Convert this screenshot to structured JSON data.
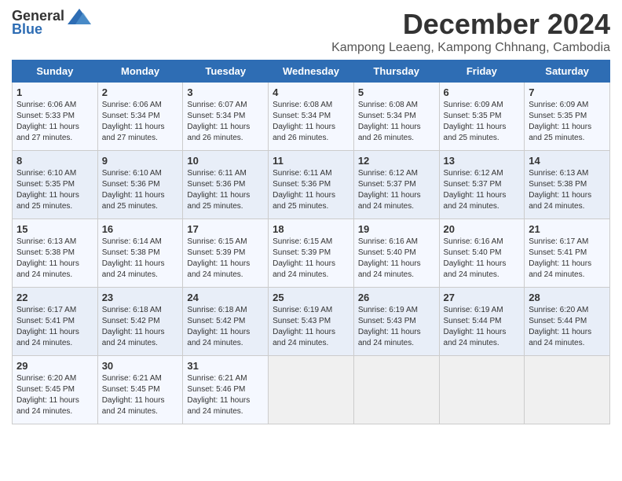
{
  "header": {
    "logo_general": "General",
    "logo_blue": "Blue",
    "month_title": "December 2024",
    "subtitle": "Kampong Leaeng, Kampong Chhnang, Cambodia"
  },
  "weekdays": [
    "Sunday",
    "Monday",
    "Tuesday",
    "Wednesday",
    "Thursday",
    "Friday",
    "Saturday"
  ],
  "weeks": [
    [
      {
        "day": "1",
        "sunrise": "Sunrise: 6:06 AM",
        "sunset": "Sunset: 5:33 PM",
        "daylight": "Daylight: 11 hours and 27 minutes."
      },
      {
        "day": "2",
        "sunrise": "Sunrise: 6:06 AM",
        "sunset": "Sunset: 5:34 PM",
        "daylight": "Daylight: 11 hours and 27 minutes."
      },
      {
        "day": "3",
        "sunrise": "Sunrise: 6:07 AM",
        "sunset": "Sunset: 5:34 PM",
        "daylight": "Daylight: 11 hours and 26 minutes."
      },
      {
        "day": "4",
        "sunrise": "Sunrise: 6:08 AM",
        "sunset": "Sunset: 5:34 PM",
        "daylight": "Daylight: 11 hours and 26 minutes."
      },
      {
        "day": "5",
        "sunrise": "Sunrise: 6:08 AM",
        "sunset": "Sunset: 5:34 PM",
        "daylight": "Daylight: 11 hours and 26 minutes."
      },
      {
        "day": "6",
        "sunrise": "Sunrise: 6:09 AM",
        "sunset": "Sunset: 5:35 PM",
        "daylight": "Daylight: 11 hours and 25 minutes."
      },
      {
        "day": "7",
        "sunrise": "Sunrise: 6:09 AM",
        "sunset": "Sunset: 5:35 PM",
        "daylight": "Daylight: 11 hours and 25 minutes."
      }
    ],
    [
      {
        "day": "8",
        "sunrise": "Sunrise: 6:10 AM",
        "sunset": "Sunset: 5:35 PM",
        "daylight": "Daylight: 11 hours and 25 minutes."
      },
      {
        "day": "9",
        "sunrise": "Sunrise: 6:10 AM",
        "sunset": "Sunset: 5:36 PM",
        "daylight": "Daylight: 11 hours and 25 minutes."
      },
      {
        "day": "10",
        "sunrise": "Sunrise: 6:11 AM",
        "sunset": "Sunset: 5:36 PM",
        "daylight": "Daylight: 11 hours and 25 minutes."
      },
      {
        "day": "11",
        "sunrise": "Sunrise: 6:11 AM",
        "sunset": "Sunset: 5:36 PM",
        "daylight": "Daylight: 11 hours and 25 minutes."
      },
      {
        "day": "12",
        "sunrise": "Sunrise: 6:12 AM",
        "sunset": "Sunset: 5:37 PM",
        "daylight": "Daylight: 11 hours and 24 minutes."
      },
      {
        "day": "13",
        "sunrise": "Sunrise: 6:12 AM",
        "sunset": "Sunset: 5:37 PM",
        "daylight": "Daylight: 11 hours and 24 minutes."
      },
      {
        "day": "14",
        "sunrise": "Sunrise: 6:13 AM",
        "sunset": "Sunset: 5:38 PM",
        "daylight": "Daylight: 11 hours and 24 minutes."
      }
    ],
    [
      {
        "day": "15",
        "sunrise": "Sunrise: 6:13 AM",
        "sunset": "Sunset: 5:38 PM",
        "daylight": "Daylight: 11 hours and 24 minutes."
      },
      {
        "day": "16",
        "sunrise": "Sunrise: 6:14 AM",
        "sunset": "Sunset: 5:38 PM",
        "daylight": "Daylight: 11 hours and 24 minutes."
      },
      {
        "day": "17",
        "sunrise": "Sunrise: 6:15 AM",
        "sunset": "Sunset: 5:39 PM",
        "daylight": "Daylight: 11 hours and 24 minutes."
      },
      {
        "day": "18",
        "sunrise": "Sunrise: 6:15 AM",
        "sunset": "Sunset: 5:39 PM",
        "daylight": "Daylight: 11 hours and 24 minutes."
      },
      {
        "day": "19",
        "sunrise": "Sunrise: 6:16 AM",
        "sunset": "Sunset: 5:40 PM",
        "daylight": "Daylight: 11 hours and 24 minutes."
      },
      {
        "day": "20",
        "sunrise": "Sunrise: 6:16 AM",
        "sunset": "Sunset: 5:40 PM",
        "daylight": "Daylight: 11 hours and 24 minutes."
      },
      {
        "day": "21",
        "sunrise": "Sunrise: 6:17 AM",
        "sunset": "Sunset: 5:41 PM",
        "daylight": "Daylight: 11 hours and 24 minutes."
      }
    ],
    [
      {
        "day": "22",
        "sunrise": "Sunrise: 6:17 AM",
        "sunset": "Sunset: 5:41 PM",
        "daylight": "Daylight: 11 hours and 24 minutes."
      },
      {
        "day": "23",
        "sunrise": "Sunrise: 6:18 AM",
        "sunset": "Sunset: 5:42 PM",
        "daylight": "Daylight: 11 hours and 24 minutes."
      },
      {
        "day": "24",
        "sunrise": "Sunrise: 6:18 AM",
        "sunset": "Sunset: 5:42 PM",
        "daylight": "Daylight: 11 hours and 24 minutes."
      },
      {
        "day": "25",
        "sunrise": "Sunrise: 6:19 AM",
        "sunset": "Sunset: 5:43 PM",
        "daylight": "Daylight: 11 hours and 24 minutes."
      },
      {
        "day": "26",
        "sunrise": "Sunrise: 6:19 AM",
        "sunset": "Sunset: 5:43 PM",
        "daylight": "Daylight: 11 hours and 24 minutes."
      },
      {
        "day": "27",
        "sunrise": "Sunrise: 6:19 AM",
        "sunset": "Sunset: 5:44 PM",
        "daylight": "Daylight: 11 hours and 24 minutes."
      },
      {
        "day": "28",
        "sunrise": "Sunrise: 6:20 AM",
        "sunset": "Sunset: 5:44 PM",
        "daylight": "Daylight: 11 hours and 24 minutes."
      }
    ],
    [
      {
        "day": "29",
        "sunrise": "Sunrise: 6:20 AM",
        "sunset": "Sunset: 5:45 PM",
        "daylight": "Daylight: 11 hours and 24 minutes."
      },
      {
        "day": "30",
        "sunrise": "Sunrise: 6:21 AM",
        "sunset": "Sunset: 5:45 PM",
        "daylight": "Daylight: 11 hours and 24 minutes."
      },
      {
        "day": "31",
        "sunrise": "Sunrise: 6:21 AM",
        "sunset": "Sunset: 5:46 PM",
        "daylight": "Daylight: 11 hours and 24 minutes."
      },
      null,
      null,
      null,
      null
    ]
  ]
}
